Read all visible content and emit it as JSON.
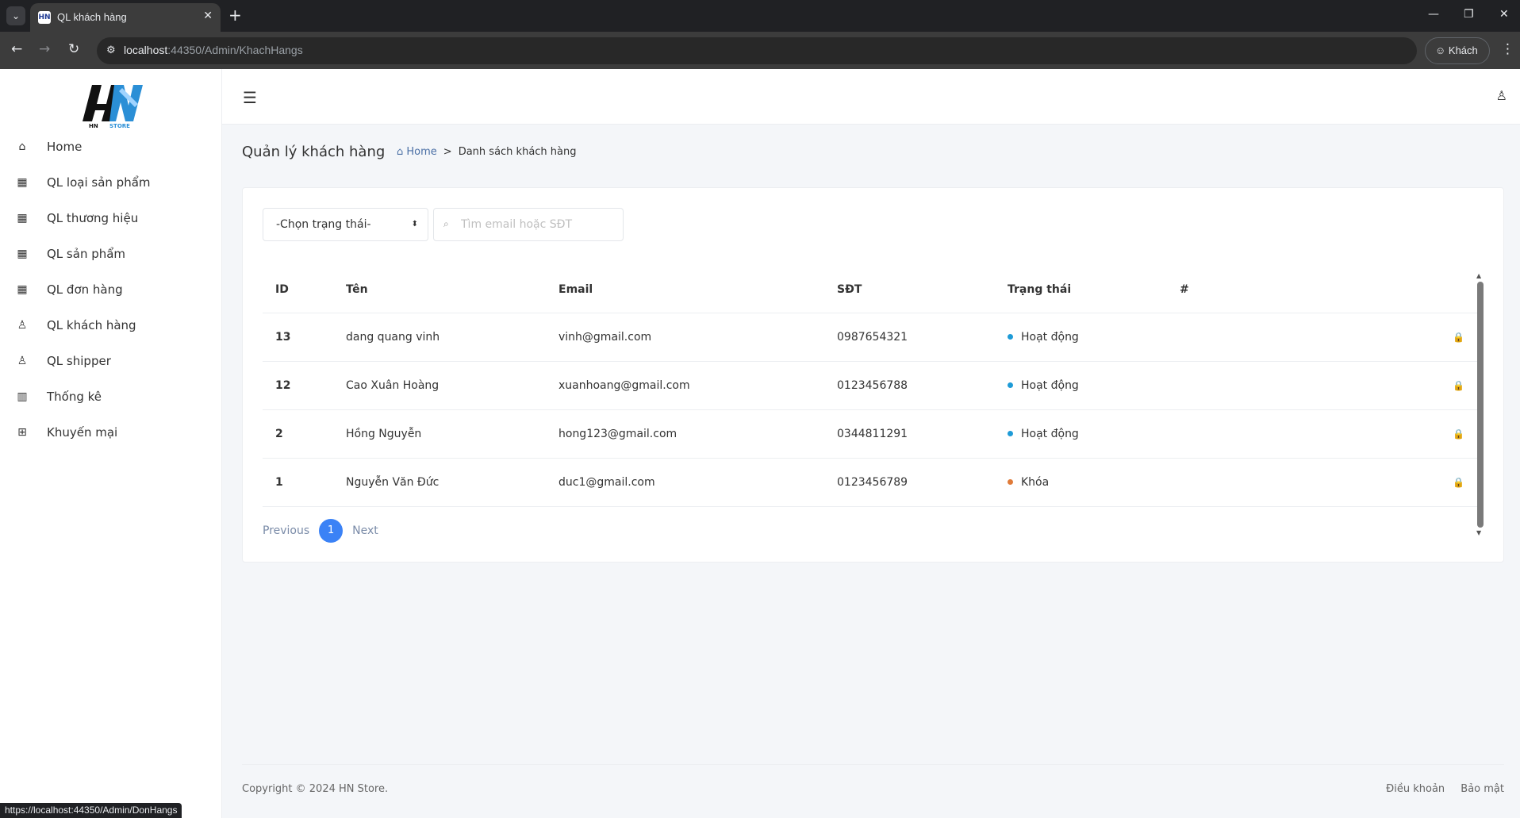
{
  "browser": {
    "tab_title": "QL khách hàng",
    "url_host": "localhost",
    "url_rest": ":44350/Admin/KhachHangs",
    "profile_label": "Khách",
    "status_url": "https://localhost:44350/Admin/DonHangs"
  },
  "sidebar": {
    "items": [
      {
        "label": "Home",
        "icon": "home-icon"
      },
      {
        "label": "QL loại sản phẩm",
        "icon": "grid-icon"
      },
      {
        "label": "QL thương hiệu",
        "icon": "grid-icon"
      },
      {
        "label": "QL sản phẩm",
        "icon": "grid-icon"
      },
      {
        "label": "QL đơn hàng",
        "icon": "grid-icon"
      },
      {
        "label": "QL khách hàng",
        "icon": "user-icon"
      },
      {
        "label": "QL shipper",
        "icon": "user-icon"
      },
      {
        "label": "Thống kê",
        "icon": "chart-icon"
      },
      {
        "label": "Khuyến mại",
        "icon": "gift-icon"
      }
    ]
  },
  "page": {
    "title": "Quản lý khách hàng",
    "breadcrumb_home": "Home",
    "breadcrumb_current": "Danh sách khách hàng"
  },
  "filters": {
    "status_selected": "-Chọn trạng thái-",
    "search_placeholder": "Tìm email hoặc SĐT"
  },
  "table": {
    "headers": [
      "ID",
      "Tên",
      "Email",
      "SĐT",
      "Trạng thái",
      "#"
    ],
    "rows": [
      {
        "id": "13",
        "name": "dang quang vinh",
        "email": "vinh@gmail.com",
        "phone": "0987654321",
        "status": "Hoạt động",
        "status_color": "#1e9bd7"
      },
      {
        "id": "12",
        "name": "Cao Xuân Hoàng",
        "email": "xuanhoang@gmail.com",
        "phone": "0123456788",
        "status": "Hoạt động",
        "status_color": "#1e9bd7"
      },
      {
        "id": "2",
        "name": "Hồng Nguyễn",
        "email": "hong123@gmail.com",
        "phone": "0344811291",
        "status": "Hoạt động",
        "status_color": "#1e9bd7"
      },
      {
        "id": "1",
        "name": "Nguyễn Văn Đức",
        "email": "duc1@gmail.com",
        "phone": "0123456789",
        "status": "Khóa",
        "status_color": "#e07b39"
      }
    ]
  },
  "pagination": {
    "prev": "Previous",
    "current": "1",
    "next": "Next"
  },
  "footer": {
    "copyright": "Copyright © 2024 HN Store.",
    "link_terms": "Điều khoản",
    "link_privacy": "Bảo mật"
  },
  "colors": {
    "accent": "#3b82f6",
    "active_status": "#1e9bd7",
    "locked_status": "#e07b39"
  }
}
